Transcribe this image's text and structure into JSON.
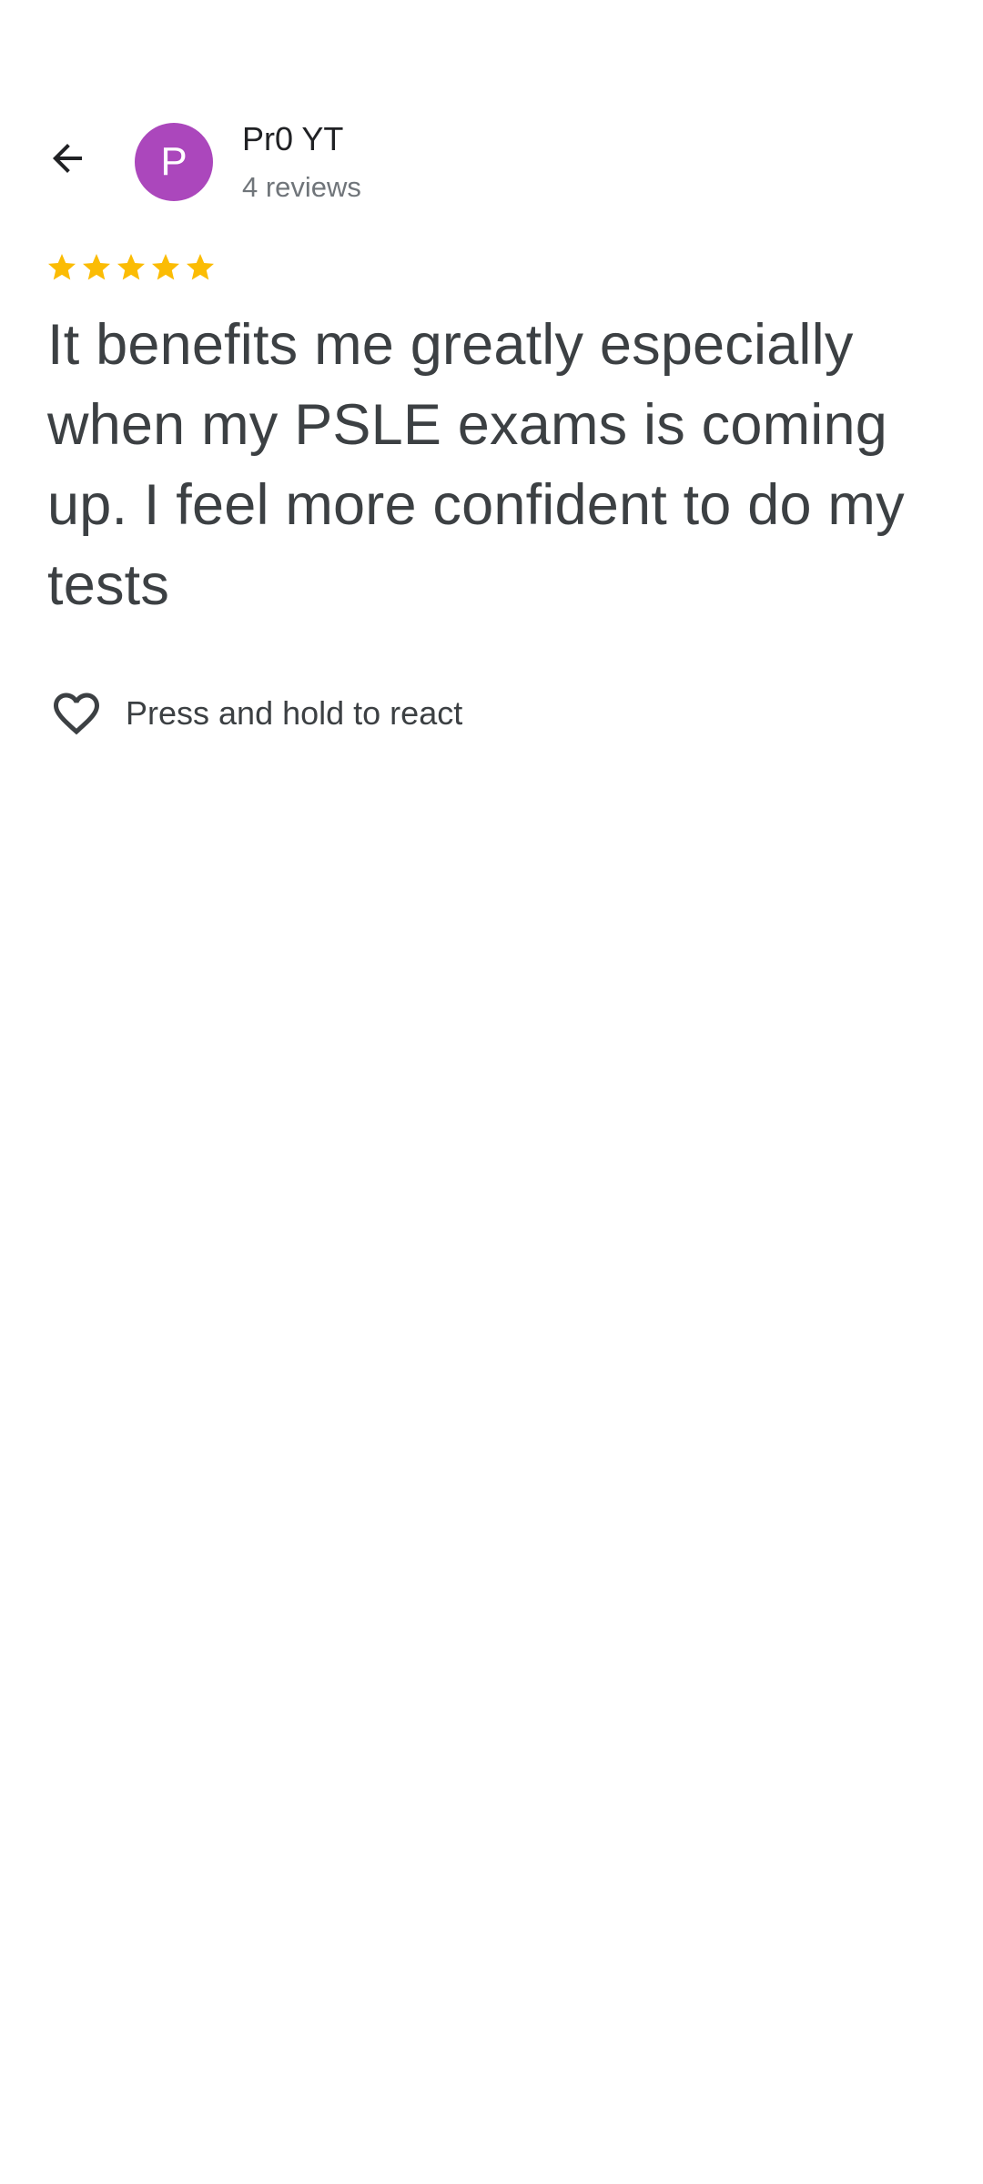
{
  "header": {
    "back_icon": "arrow-left-icon",
    "avatar_letter": "P",
    "avatar_color": "#ab47bc",
    "author_name": "Pr0 YT",
    "review_count": "4 reviews"
  },
  "review": {
    "rating": 5,
    "rating_max": 5,
    "star_color": "#fbbc04",
    "text": "It benefits me greatly especially when my PSLE exams is coming up. I feel more confident to do my tests"
  },
  "reaction": {
    "icon": "heart-outline-icon",
    "label": "Press and hold to react"
  }
}
